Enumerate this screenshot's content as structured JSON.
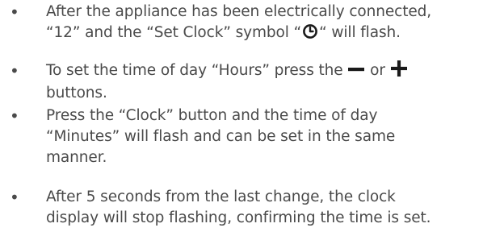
{
  "instructions": {
    "bullet_symbol": "•",
    "items": [
      {
        "lines": [
          "After the appliance has been electrically connected,",
          "“12” and the “Set Clock” symbol “",
          "“ will flash."
        ],
        "icon": "clock-symbol-icon"
      },
      {
        "lines": [
          "To set the time of day “Hours” press the",
          "or",
          "buttons."
        ],
        "icons": [
          "minus-button-icon",
          "plus-button-icon"
        ]
      },
      {
        "lines": [
          "Press the “Clock” button and the time of day",
          "“Minutes” will flash and can be set in the same",
          "manner."
        ]
      },
      {
        "lines": [
          "After 5 seconds from the last change, the clock",
          "display will stop flashing, confirming the time is set."
        ]
      }
    ]
  }
}
